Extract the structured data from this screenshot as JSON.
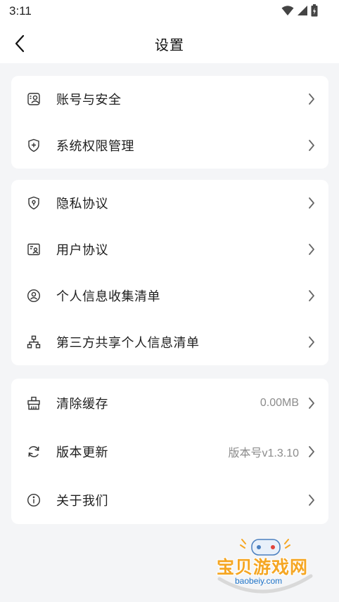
{
  "status_bar": {
    "time": "3:11"
  },
  "header": {
    "title": "设置"
  },
  "groups": [
    {
      "items": [
        {
          "label": "账号与安全",
          "icon": "account-security-icon"
        },
        {
          "label": "系统权限管理",
          "icon": "shield-plus-icon"
        }
      ]
    },
    {
      "items": [
        {
          "label": "隐私协议",
          "icon": "shield-lock-icon"
        },
        {
          "label": "用户协议",
          "icon": "user-card-icon"
        },
        {
          "label": "个人信息收集清单",
          "icon": "user-circle-icon"
        },
        {
          "label": "第三方共享个人信息清单",
          "icon": "org-tree-icon"
        }
      ]
    },
    {
      "items": [
        {
          "label": "清除缓存",
          "value": "0.00MB",
          "icon": "broom-icon"
        },
        {
          "label": "版本更新",
          "value": "版本号v1.3.10",
          "icon": "refresh-icon"
        },
        {
          "label": "关于我们",
          "icon": "info-icon"
        }
      ]
    }
  ],
  "watermark": {
    "text": "宝贝游戏网",
    "url": "baobeiy.com"
  },
  "colors": {
    "accent": "#f5a623",
    "background": "#f4f5f7",
    "card": "#ffffff",
    "muted": "#8c8c8c"
  }
}
